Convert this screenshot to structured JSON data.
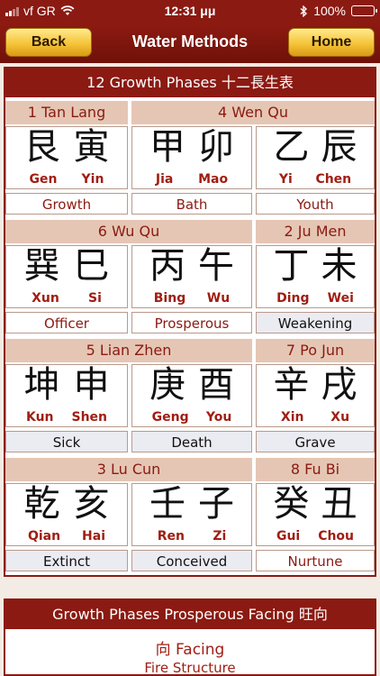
{
  "status_bar": {
    "carrier": "vf GR",
    "time": "12:31 μμ",
    "battery": "100%"
  },
  "nav": {
    "back_label": "Back",
    "title": "Water Methods",
    "home_label": "Home"
  },
  "table": {
    "title": "12 Growth Phases 十二長生表",
    "rows": [
      {
        "stars": [
          "1 Tan Lang",
          "4 Wen Qu"
        ],
        "cells": [
          {
            "chars": [
              "艮",
              "寅"
            ],
            "names": [
              "Gen",
              "Yin"
            ],
            "phase": "Growth",
            "phase_style": "red"
          },
          {
            "chars": [
              "甲",
              "卯"
            ],
            "names": [
              "Jia",
              "Mao"
            ],
            "phase": "Bath",
            "phase_style": "red"
          },
          {
            "chars": [
              "乙",
              "辰"
            ],
            "names": [
              "Yi",
              "Chen"
            ],
            "phase": "Youth",
            "phase_style": "red"
          }
        ]
      },
      {
        "stars": [
          "6 Wu Qu",
          "2 Ju Men"
        ],
        "cells": [
          {
            "chars": [
              "巽",
              "巳"
            ],
            "names": [
              "Xun",
              "Si"
            ],
            "phase": "Officer",
            "phase_style": "red"
          },
          {
            "chars": [
              "丙",
              "午"
            ],
            "names": [
              "Bing",
              "Wu"
            ],
            "phase": "Prosperous",
            "phase_style": "red"
          },
          {
            "chars": [
              "丁",
              "未"
            ],
            "names": [
              "Ding",
              "Wei"
            ],
            "phase": "Weakening",
            "phase_style": "dark"
          }
        ]
      },
      {
        "stars": [
          "5 Lian Zhen",
          "7 Po Jun"
        ],
        "cells": [
          {
            "chars": [
              "坤",
              "申"
            ],
            "names": [
              "Kun",
              "Shen"
            ],
            "phase": "Sick",
            "phase_style": "dark"
          },
          {
            "chars": [
              "庚",
              "酉"
            ],
            "names": [
              "Geng",
              "You"
            ],
            "phase": "Death",
            "phase_style": "dark"
          },
          {
            "chars": [
              "辛",
              "戌"
            ],
            "names": [
              "Xin",
              "Xu"
            ],
            "phase": "Grave",
            "phase_style": "dark"
          }
        ]
      },
      {
        "stars": [
          "3 Lu Cun",
          "8 Fu Bi"
        ],
        "cells": [
          {
            "chars": [
              "乾",
              "亥"
            ],
            "names": [
              "Qian",
              "Hai"
            ],
            "phase": "Extinct",
            "phase_style": "dark"
          },
          {
            "chars": [
              "壬",
              "子"
            ],
            "names": [
              "Ren",
              "Zi"
            ],
            "phase": "Conceived",
            "phase_style": "dark"
          },
          {
            "chars": [
              "癸",
              "丑"
            ],
            "names": [
              "Gui",
              "Chou"
            ],
            "phase": "Nurtune",
            "phase_style": "red"
          }
        ]
      }
    ]
  },
  "facing_section": {
    "title": "Growth Phases Prosperous Facing 旺向",
    "facing_label": "向 Facing",
    "structure": "Fire Structure"
  },
  "colors": {
    "brand_red": "#8b1a12",
    "gold": "#f5c43a",
    "star_band": "#e5c6b4",
    "battery_green": "#3fd35a"
  },
  "icons": [
    "signal-bars-icon",
    "wifi-icon",
    "bluetooth-icon",
    "battery-icon"
  ]
}
